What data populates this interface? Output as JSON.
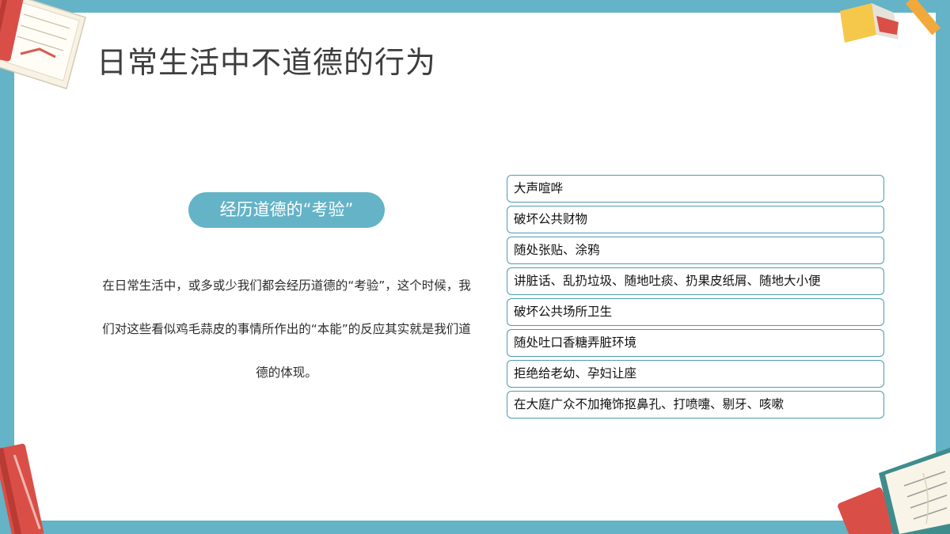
{
  "title": "日常生活中不道德的行为",
  "badge": "经历道德的“考验”",
  "paragraph": "在日常生活中，或多或少我们都会经历道德的“考验”，这个时候，我们对这些看似鸡毛蒜皮的事情所作出的“本能”的反应其实就是我们道德的体现。",
  "items": [
    "大声喧哗",
    "破坏公共财物",
    "随处张贴、涂鸦",
    "讲脏话、乱扔垃圾、随地吐痰、扔果皮纸屑、随地大小便",
    "破坏公共场所卫生",
    "随处吐口香糖弄脏环境",
    "拒绝给老幼、孕妇让座",
    "在大庭广众不加掩饰抠鼻孔、打喷嚏、剔牙、咳嗽"
  ],
  "colors": {
    "frame": "#64b3c7",
    "badge": "#64b3c7",
    "item_border": "#4f9bae",
    "title": "#3d3d3d"
  }
}
